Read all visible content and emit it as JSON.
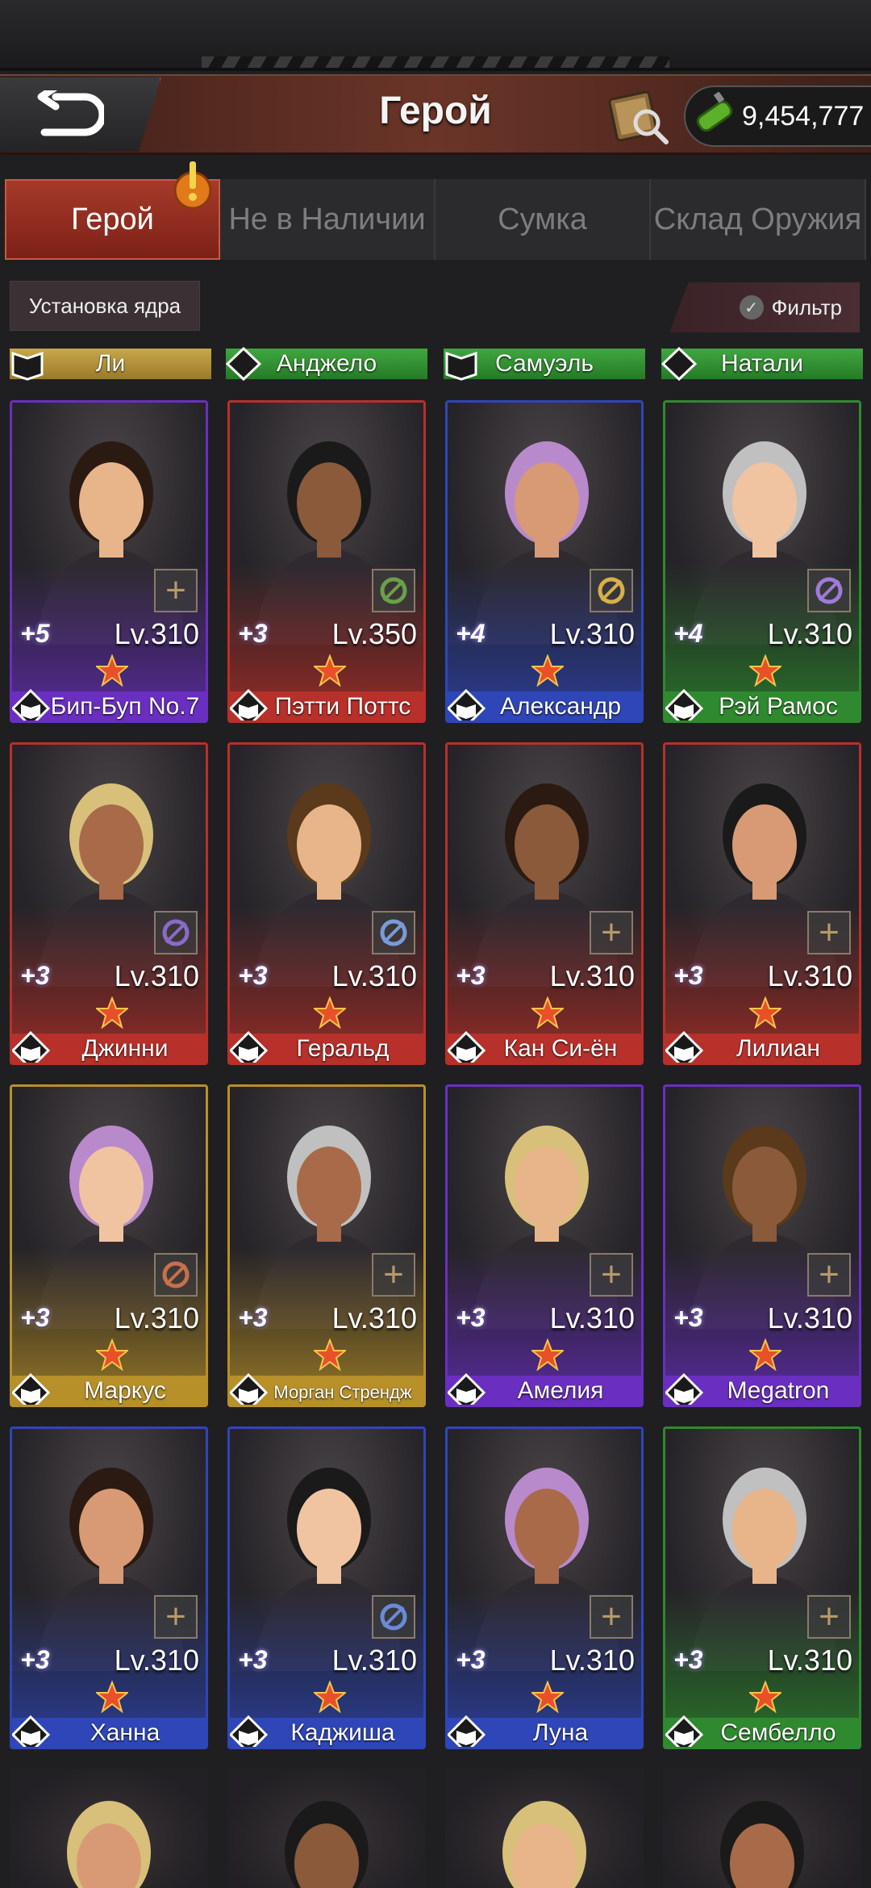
{
  "header": {
    "title": "Герой",
    "currency_value": "9,454,777"
  },
  "tabs": [
    {
      "label": "Герой",
      "active": true
    },
    {
      "label": "Не в Наличии",
      "active": false
    },
    {
      "label": "Сумка",
      "active": false
    },
    {
      "label": "Склад Оружия",
      "active": false
    }
  ],
  "toolbar": {
    "core_install": "Установка ядра",
    "filter": "Фильтр"
  },
  "top_names": [
    "Ли",
    "Анджело",
    "Самуэль",
    "Натали"
  ],
  "heroes": [
    {
      "name": "Бип-Буп No.7",
      "level": "Lv.310",
      "plus": "+5",
      "rarity": "purple",
      "equip": "plus"
    },
    {
      "name": "Пэтти Поттс",
      "level": "Lv.350",
      "plus": "+3",
      "rarity": "red",
      "equip": "pan"
    },
    {
      "name": "Александр",
      "level": "Lv.310",
      "plus": "+4",
      "rarity": "blue",
      "equip": "necklace"
    },
    {
      "name": "Рэй Рамос",
      "level": "Lv.310",
      "plus": "+4",
      "rarity": "green",
      "equip": "headphones"
    },
    {
      "name": "Джинни",
      "level": "Lv.310",
      "plus": "+3",
      "rarity": "red",
      "equip": "rifle"
    },
    {
      "name": "Геральд",
      "level": "Lv.310",
      "plus": "+3",
      "rarity": "red",
      "equip": "blade"
    },
    {
      "name": "Кан Си-ён",
      "level": "Lv.310",
      "plus": "+3",
      "rarity": "red",
      "equip": "plus"
    },
    {
      "name": "Лилиан",
      "level": "Lv.310",
      "plus": "+3",
      "rarity": "red",
      "equip": "plus"
    },
    {
      "name": "Маркус",
      "level": "Lv.310",
      "plus": "+3",
      "rarity": "gold",
      "equip": "fist"
    },
    {
      "name": "Морган Стрендж",
      "level": "Lv.310",
      "plus": "+3",
      "rarity": "gold",
      "equip": "plus"
    },
    {
      "name": "Амелия",
      "level": "Lv.310",
      "plus": "+3",
      "rarity": "purple",
      "equip": "plus"
    },
    {
      "name": "Megatron",
      "level": "Lv.310",
      "plus": "+3",
      "rarity": "purple",
      "equip": "plus"
    },
    {
      "name": "Ханна",
      "level": "Lv.310",
      "plus": "+3",
      "rarity": "blue",
      "equip": "plus"
    },
    {
      "name": "Каджиша",
      "level": "Lv.310",
      "plus": "+3",
      "rarity": "blue",
      "equip": "gun"
    },
    {
      "name": "Луна",
      "level": "Lv.310",
      "plus": "+3",
      "rarity": "blue",
      "equip": "plus"
    },
    {
      "name": "Сембелло",
      "level": "Lv.310",
      "plus": "+3",
      "rarity": "green",
      "equip": "plus"
    }
  ],
  "colors": {
    "purple": "#6a2fc0",
    "red": "#b8302a",
    "blue": "#2f46b8",
    "green": "#2f8a2f",
    "gold": "#b8902a",
    "accent_tab": "#a63a2a"
  }
}
